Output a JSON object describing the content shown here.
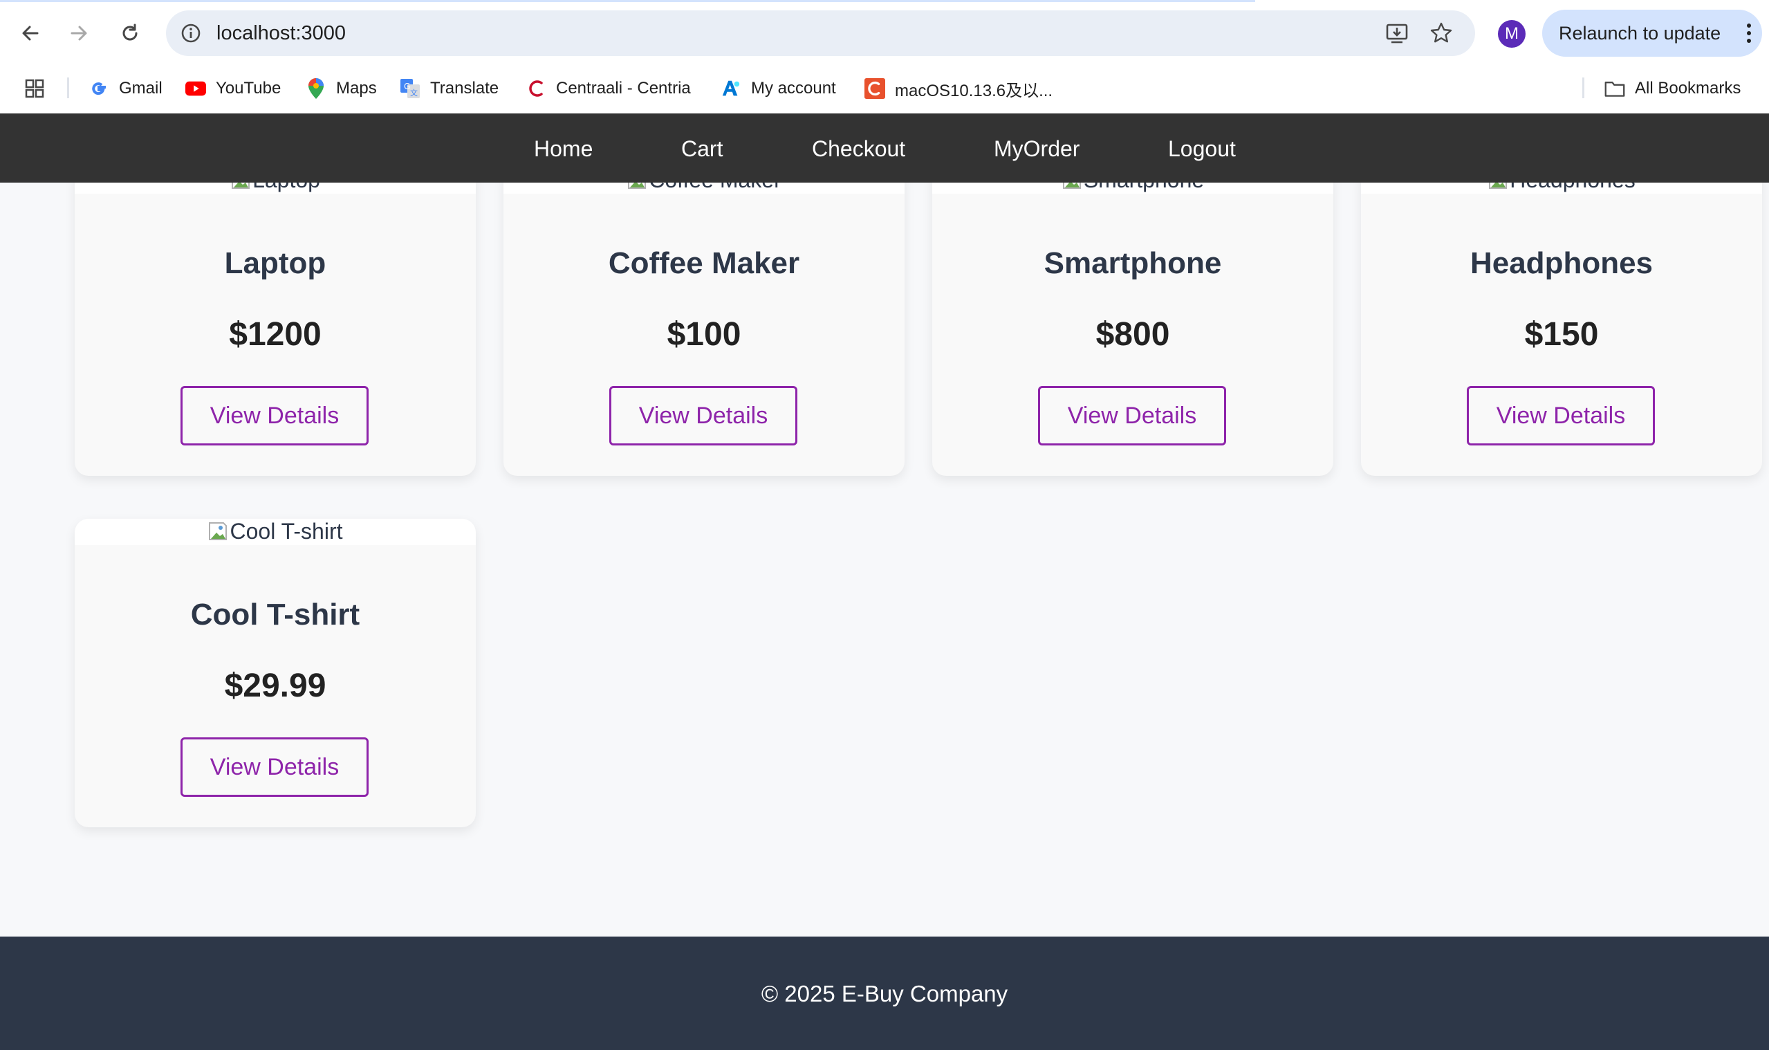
{
  "browser": {
    "url": "localhost:3000",
    "avatar_initial": "M",
    "relaunch_label": "Relaunch to update",
    "bookmarks": [
      {
        "label": "Gmail",
        "icon": "gmail-icon"
      },
      {
        "label": "YouTube",
        "icon": "youtube-icon"
      },
      {
        "label": "Maps",
        "icon": "maps-icon"
      },
      {
        "label": "Translate",
        "icon": "translate-icon"
      },
      {
        "label": "Centraali - Centria",
        "icon": "centria-icon"
      },
      {
        "label": "My account",
        "icon": "account-icon"
      },
      {
        "label": "macOS10.13.6及以...",
        "icon": "c-logo-icon"
      }
    ],
    "all_bookmarks_label": "All Bookmarks"
  },
  "nav": {
    "links": [
      "Home",
      "Cart",
      "Checkout",
      "MyOrder",
      "Logout"
    ]
  },
  "products": [
    {
      "name": "Laptop",
      "alt": "Laptop",
      "price": "$1200",
      "button": "View Details"
    },
    {
      "name": "Coffee Maker",
      "alt": "Coffee Maker",
      "price": "$100",
      "button": "View Details"
    },
    {
      "name": "Smartphone",
      "alt": "Smartphone",
      "price": "$800",
      "button": "View Details"
    },
    {
      "name": "Headphones",
      "alt": "Headphones",
      "price": "$150",
      "button": "View Details"
    },
    {
      "name": "Cool T-shirt",
      "alt": "Cool T-shirt",
      "price": "$29.99",
      "button": "View Details"
    }
  ],
  "footer": {
    "text": "© 2025 E-Buy Company"
  },
  "colors": {
    "nav_bg": "#333333",
    "footer_bg": "#2d3748",
    "accent": "#8e24aa",
    "page_bg": "#f7f8fa"
  }
}
